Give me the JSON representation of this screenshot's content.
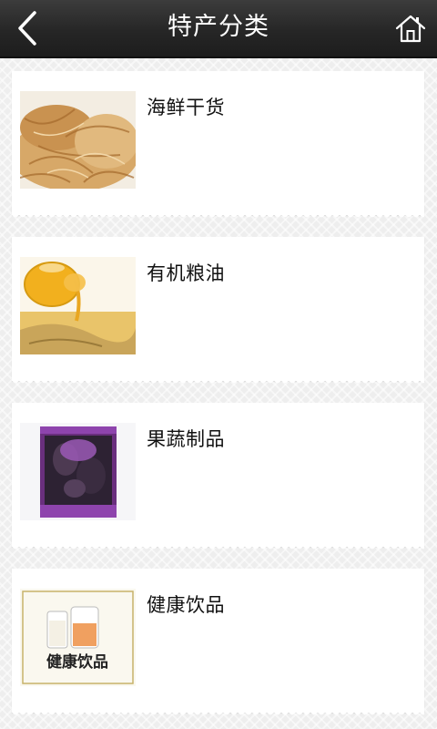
{
  "header": {
    "title": "特产分类",
    "back_icon": "chevron-left-icon",
    "home_icon": "home-icon"
  },
  "categories": [
    {
      "label": "海鲜干货",
      "image": "dried-seafood-image"
    },
    {
      "label": "有机粮油",
      "image": "cooking-oil-image"
    },
    {
      "label": "果蔬制品",
      "image": "packaged-dried-fruit-image"
    },
    {
      "label": "健康饮品",
      "image": "health-drinks-image",
      "image_caption": "健康饮品"
    }
  ],
  "colors": {
    "header_bg": "#262626",
    "page_bg": "#eeeeee",
    "card_bg": "#ffffff",
    "text": "#111111"
  }
}
